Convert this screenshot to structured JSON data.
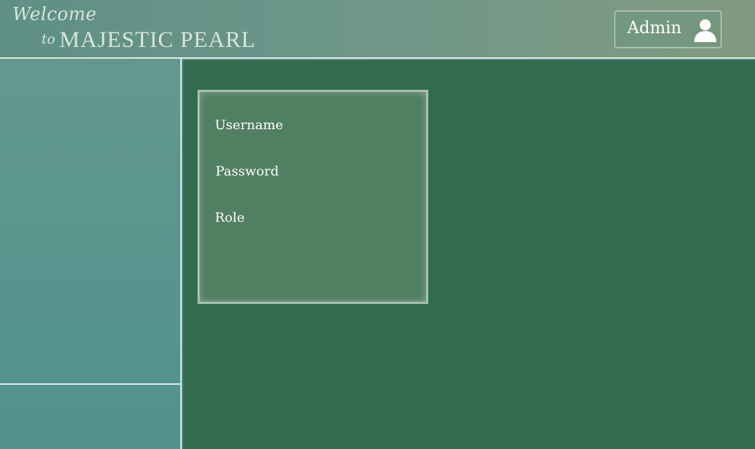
{
  "header": {
    "welcome_text": "Welcome",
    "to_text": "to",
    "brand_name": "MAJESTIC PEARL",
    "admin_label": "Admin"
  },
  "icons": {
    "user": "user-icon"
  },
  "form": {
    "username_label": "Username",
    "password_label": "Password",
    "role_label": "Role"
  },
  "colors": {
    "main_background": "#336b4f",
    "card_background": "#517f62",
    "sidebar_background": "#5a958f",
    "header_background": "#6f978a"
  }
}
